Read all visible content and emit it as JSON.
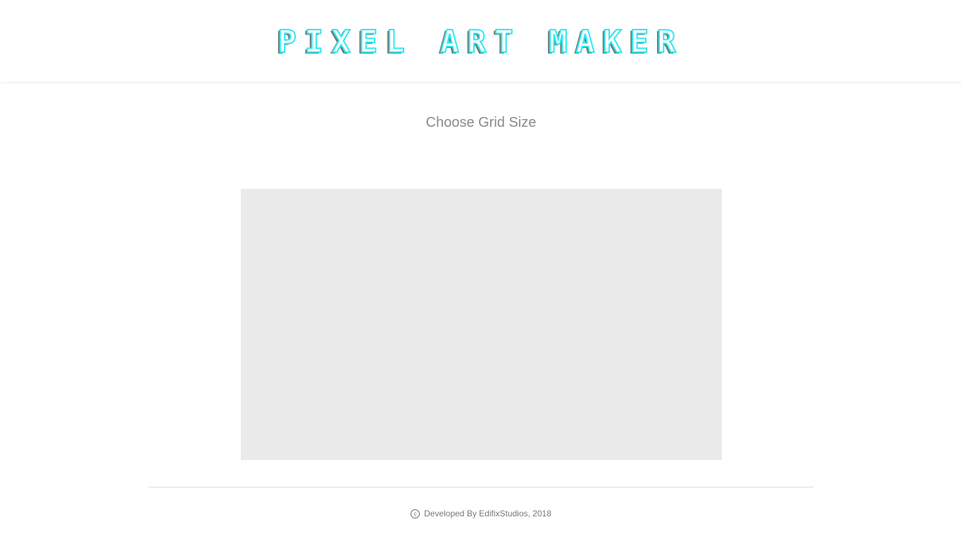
{
  "header": {
    "logo_text": "PIXEL ART MAKER"
  },
  "main": {
    "grid_title": "Choose Grid Size"
  },
  "footer": {
    "copyright_symbol": "c",
    "text": "Developed By EdifixStudios, 2018"
  },
  "colors": {
    "logo_outline": "#2ee9f0",
    "logo_shadow": "#6b7b7c",
    "canvas_bg": "#eaeaea",
    "title_text": "#8a8a8a"
  }
}
